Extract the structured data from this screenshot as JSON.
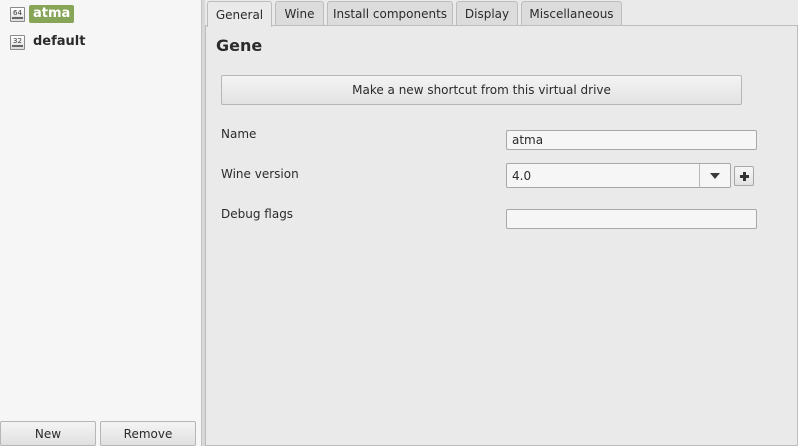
{
  "prefixes": [
    {
      "label": "atma",
      "arch": "64",
      "selected": true
    },
    {
      "label": "default",
      "arch": "32",
      "selected": false
    }
  ],
  "left_buttons": {
    "new": "New",
    "remove": "Remove"
  },
  "tabs": [
    {
      "label": "General",
      "active": true
    },
    {
      "label": "Wine",
      "active": false
    },
    {
      "label": "Install components",
      "active": false
    },
    {
      "label": "Display",
      "active": false
    },
    {
      "label": "Miscellaneous",
      "active": false
    }
  ],
  "general": {
    "title": "Gene",
    "shortcut_button": "Make a new shortcut from this virtual drive",
    "name_label": "Name",
    "name_value": "atma",
    "wine_version_label": "Wine version",
    "wine_version_value": "4.0",
    "debug_flags_label": "Debug flags",
    "debug_flags_value": ""
  },
  "colors": {
    "selection": "#87a556",
    "background": "#eaeaea"
  },
  "icons": {
    "dropdown": "chevron-down-icon",
    "add": "plus-icon"
  }
}
